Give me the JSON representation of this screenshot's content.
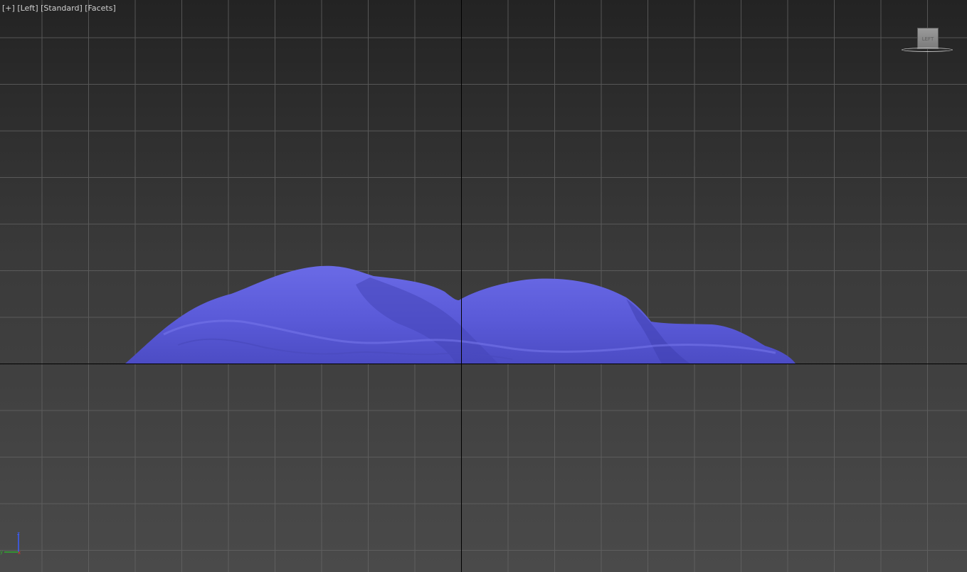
{
  "viewport": {
    "menu_plus": "+",
    "view_name": "Left",
    "shading": "Standard",
    "edges": "Facets"
  },
  "viewcube": {
    "face_label": "LEFT"
  },
  "axis": {
    "z": "z",
    "y": "y",
    "x": "x",
    "colors": {
      "z": "#3a5cff",
      "y": "#2faa2f",
      "x": "#e03030"
    }
  },
  "colors": {
    "mesh": "#5b5bd6",
    "grid": "#6a6a6a",
    "world_axis": "#000000"
  },
  "icons": [
    "viewcube-icon",
    "axis-tripod-icon"
  ]
}
